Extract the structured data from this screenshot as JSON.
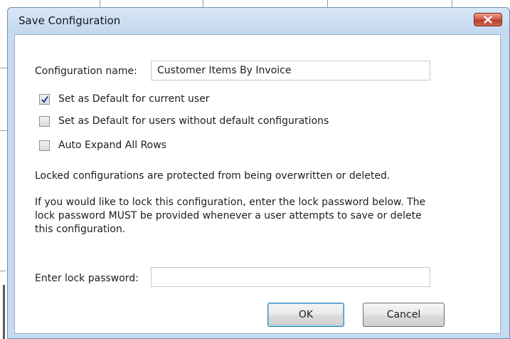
{
  "dialog": {
    "title": "Save Configuration"
  },
  "form": {
    "config_name_label": "Configuration name:",
    "config_name_value": "Customer Items By Invoice",
    "checkboxes": [
      {
        "label": "Set as Default for current user",
        "checked": true
      },
      {
        "label": "Set as Default for users without default configurations",
        "checked": false
      },
      {
        "label": "Auto Expand All Rows",
        "checked": false
      }
    ],
    "locked_info": "Locked configurations are protected from being overwritten or deleted.",
    "lock_instructions_1": "If you would like to lock  this  configuration, enter the lock password below. The",
    "lock_instructions_2": "lock password MUST be provided whenever a user attempts to save or delete",
    "lock_instructions_3": "this  configuration.",
    "lock_password_label": "Enter lock password:",
    "lock_password_value": ""
  },
  "buttons": {
    "ok": "OK",
    "cancel": "Cancel"
  },
  "icons": {
    "close": "close-icon",
    "check": "checkmark-icon"
  },
  "colors": {
    "titlebar": "#c6dbf0",
    "close_button": "#c9503b",
    "default_button_border": "#3c7fb1"
  }
}
